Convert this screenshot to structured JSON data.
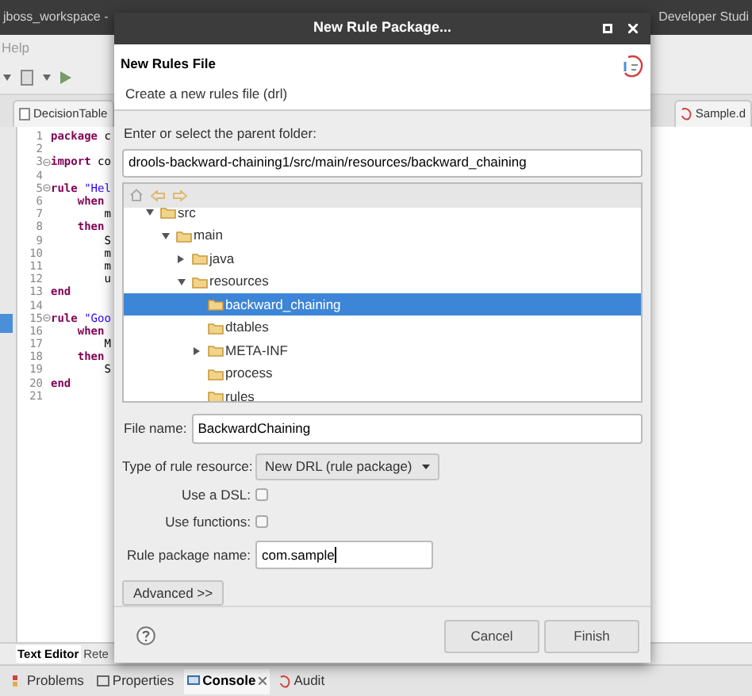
{
  "window": {
    "title": "jboss_workspace -",
    "title_right": "Developer Studi"
  },
  "menu": [
    "Help"
  ],
  "editor_tabs": [
    {
      "label": "DecisionTable",
      "selected": false
    },
    {
      "label": "Sample.d",
      "selected": false
    }
  ],
  "code_lines": [
    {
      "number": "1",
      "fold": false,
      "tokens": [
        {
          "kind": "keyword",
          "text": "package"
        },
        {
          "kind": "plain",
          "text": " c"
        }
      ]
    },
    {
      "number": "2",
      "fold": false
    },
    {
      "number": "3",
      "fold": true,
      "tokens": [
        {
          "kind": "keyword",
          "text": "import"
        },
        {
          "kind": "plain",
          "text": " co"
        }
      ]
    },
    {
      "number": "4",
      "fold": false
    },
    {
      "number": "5",
      "fold": true,
      "tokens": [
        {
          "kind": "keyword",
          "text": "rule"
        },
        {
          "kind": "string",
          "text": " \"Hel"
        }
      ]
    },
    {
      "number": "6",
      "fold": false,
      "tokens": [
        {
          "kind": "keyword",
          "text": "    when"
        }
      ]
    },
    {
      "number": "7",
      "fold": false,
      "tokens": [
        {
          "kind": "plain",
          "text": "        m"
        }
      ]
    },
    {
      "number": "8",
      "fold": false,
      "tokens": [
        {
          "kind": "keyword",
          "text": "    then"
        }
      ]
    },
    {
      "number": "9",
      "fold": false,
      "tokens": [
        {
          "kind": "plain",
          "text": "        S"
        }
      ]
    },
    {
      "number": "10",
      "fold": false,
      "tokens": [
        {
          "kind": "plain",
          "text": "        m"
        }
      ]
    },
    {
      "number": "11",
      "fold": false,
      "tokens": [
        {
          "kind": "plain",
          "text": "        m"
        }
      ]
    },
    {
      "number": "12",
      "fold": false,
      "tokens": [
        {
          "kind": "plain",
          "text": "        u"
        }
      ]
    },
    {
      "number": "13",
      "fold": false,
      "tokens": [
        {
          "kind": "keyword",
          "text": "end"
        }
      ]
    },
    {
      "number": "14",
      "fold": false
    },
    {
      "number": "15",
      "fold": true,
      "tokens": [
        {
          "kind": "keyword",
          "text": "rule"
        },
        {
          "kind": "string",
          "text": " \"Goo"
        }
      ]
    },
    {
      "number": "16",
      "fold": false,
      "tokens": [
        {
          "kind": "keyword",
          "text": "    when"
        }
      ]
    },
    {
      "number": "17",
      "fold": false,
      "tokens": [
        {
          "kind": "plain",
          "text": "        M"
        }
      ]
    },
    {
      "number": "18",
      "fold": false,
      "tokens": [
        {
          "kind": "keyword",
          "text": "    then"
        }
      ]
    },
    {
      "number": "19",
      "fold": false,
      "tokens": [
        {
          "kind": "plain",
          "text": "        S"
        }
      ]
    },
    {
      "number": "20",
      "fold": false,
      "tokens": [
        {
          "kind": "keyword",
          "text": "end"
        }
      ]
    },
    {
      "number": "21",
      "fold": false
    }
  ],
  "editor_bottom_tabs": [
    {
      "label": "Text Editor",
      "selected": true
    },
    {
      "label": "Rete",
      "selected": false
    }
  ],
  "panel_tabs": [
    {
      "label": "Problems",
      "selected": false
    },
    {
      "label": "Properties",
      "selected": false
    },
    {
      "label": "Console",
      "selected": true
    },
    {
      "label": "Audit",
      "selected": false
    }
  ],
  "dialog": {
    "title": "New Rule Package...",
    "header_title": "New Rules File",
    "header_description": "Create a new rules file (drl)",
    "folder_label": "Enter or select the parent folder:",
    "folder_value": "drools-backward-chaining1/src/main/resources/backward_chaining",
    "tree": [
      {
        "label": "src",
        "expanded": true,
        "selected": false,
        "children": [
          {
            "label": "main",
            "expanded": true,
            "selected": false,
            "children": [
              {
                "label": "java",
                "expanded": false,
                "selected": false
              },
              {
                "label": "resources",
                "expanded": true,
                "selected": false,
                "children": [
                  {
                    "label": "backward_chaining",
                    "selected": true
                  },
                  {
                    "label": "dtables",
                    "selected": false
                  },
                  {
                    "label": "META-INF",
                    "expanded": false,
                    "selected": false
                  },
                  {
                    "label": "process",
                    "selected": false
                  },
                  {
                    "label": "rules",
                    "selected": false
                  }
                ]
              }
            ]
          }
        ]
      }
    ],
    "file_name_label": "File name:",
    "file_name_value": "BackwardChaining",
    "type_label": "Type of rule resource:",
    "type_value": "New DRL (rule package)",
    "options": [
      {
        "label": "Use a DSL:",
        "checked": false
      },
      {
        "label": "Use functions:",
        "checked": false
      }
    ],
    "package_label": "Rule package name:",
    "package_value": "com.sample",
    "advanced_button": "Advanced >>",
    "buttons": [
      {
        "label": "Cancel",
        "disabled": false
      },
      {
        "label": "Finish",
        "disabled": false
      }
    ]
  }
}
